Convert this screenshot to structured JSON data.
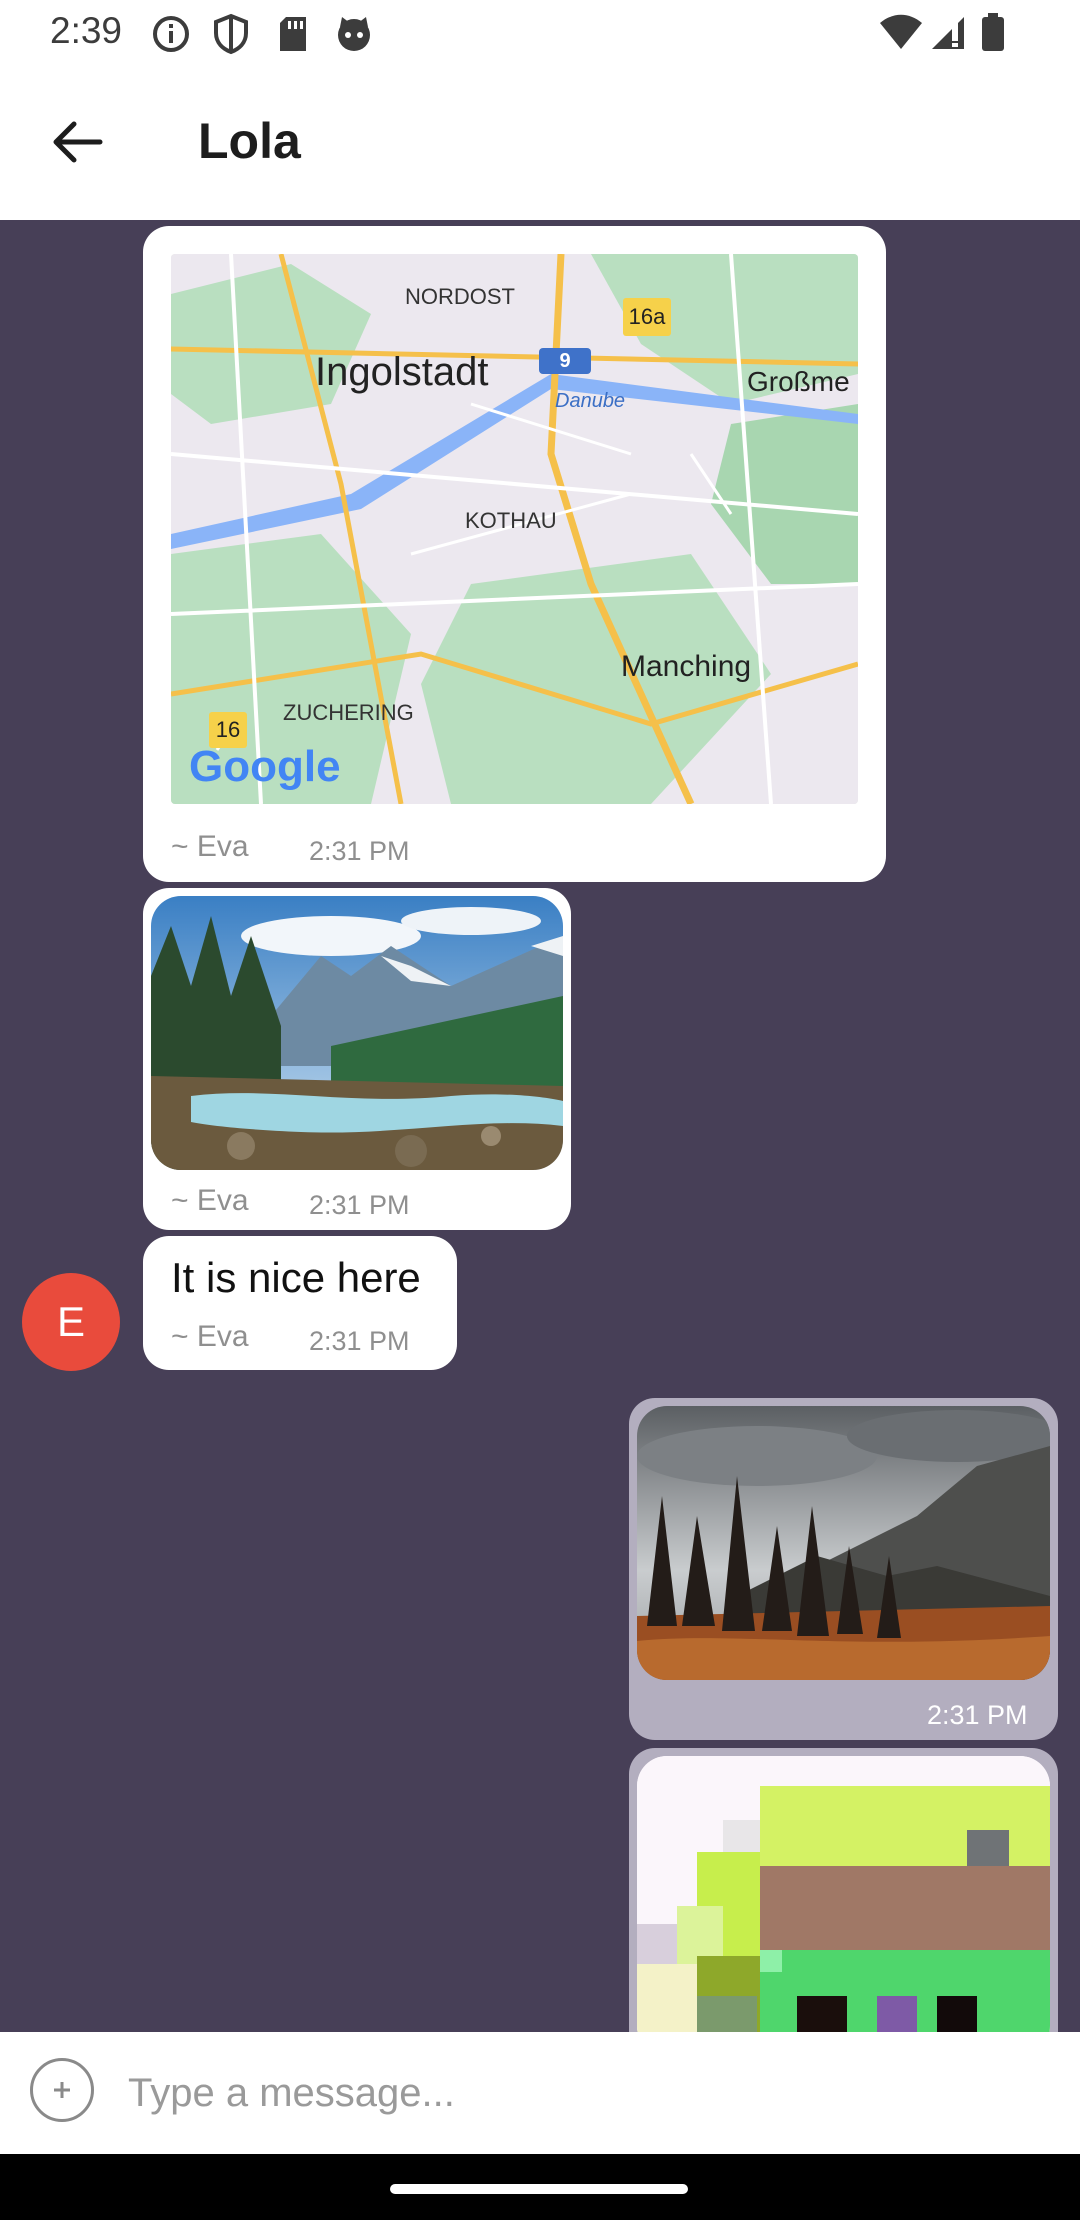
{
  "status_bar": {
    "time": "2:39"
  },
  "header": {
    "title": "Lola"
  },
  "messages": [
    {
      "type": "map",
      "sender": "~ Eva",
      "time": "2:31 PM",
      "map_labels": {
        "nordost": "NORDOST",
        "ingolstadt": "Ingolstadt",
        "danube": "Danube",
        "grossme": "Großme",
        "kothau": "KOTHAU",
        "manching": "Manching",
        "zuchering": "ZUCHERING",
        "route_9": "9",
        "route_16a": "16a",
        "route_16": "16",
        "brand": "Google"
      }
    },
    {
      "type": "image",
      "sender": "~ Eva",
      "time": "2:31 PM",
      "image": "mountain-river-photo"
    },
    {
      "type": "text",
      "sender": "~ Eva",
      "time": "2:31 PM",
      "text": "It is nice here"
    },
    {
      "type": "image",
      "outgoing": true,
      "time": "2:31 PM",
      "image": "dark-forest-mountain-photo"
    },
    {
      "type": "image",
      "outgoing": true,
      "image": "pixel-art-image"
    }
  ],
  "avatar": {
    "initial": "E",
    "color": "#e94b3c"
  },
  "composer": {
    "placeholder": "Type a message..."
  },
  "colors": {
    "chat_bg": "#473f57",
    "incoming_bubble": "#ffffff",
    "outgoing_bubble": "#b3aebf"
  }
}
